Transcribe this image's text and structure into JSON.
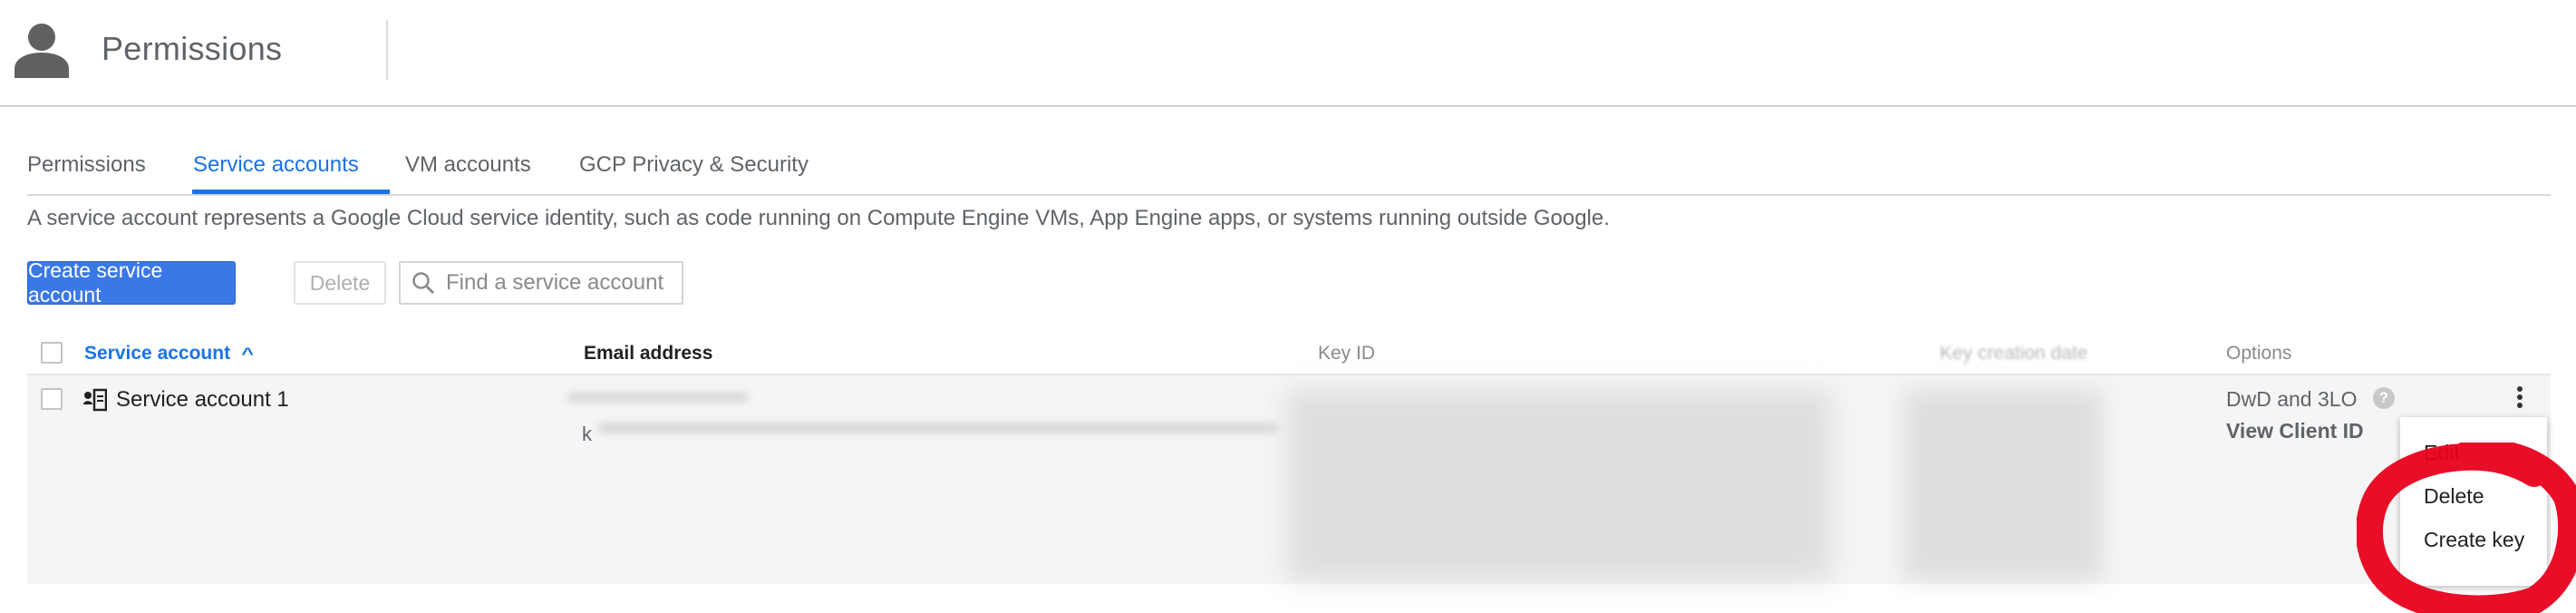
{
  "header": {
    "title": "Permissions",
    "icon": "person-icon"
  },
  "tabs": [
    {
      "label": "Permissions",
      "active": false
    },
    {
      "label": "Service accounts",
      "active": true
    },
    {
      "label": "VM accounts",
      "active": false
    },
    {
      "label": "GCP Privacy & Security",
      "active": false
    }
  ],
  "description": "A service account represents a Google Cloud service identity, such as code running on Compute Engine VMs, App Engine apps, or systems running outside Google.",
  "toolbar": {
    "create_label": "Create service account",
    "delete_label": "Delete",
    "search_placeholder": "Find a service account"
  },
  "table": {
    "columns": [
      "Service account",
      "Email address",
      "Key ID",
      "Key creation date",
      "Options"
    ],
    "sort_indicator": "^",
    "rows": [
      {
        "name": "Service account 1",
        "email_visible_prefix": "k",
        "options": "DwD and 3LO",
        "help_glyph": "?",
        "view_client_id": "View Client ID"
      }
    ]
  },
  "menu": {
    "items": [
      "Edit",
      "Delete",
      "Create key"
    ]
  },
  "colors": {
    "accent": "#1a73e8",
    "primary_button": "#3b78e7",
    "annotation": "#e8001c"
  }
}
